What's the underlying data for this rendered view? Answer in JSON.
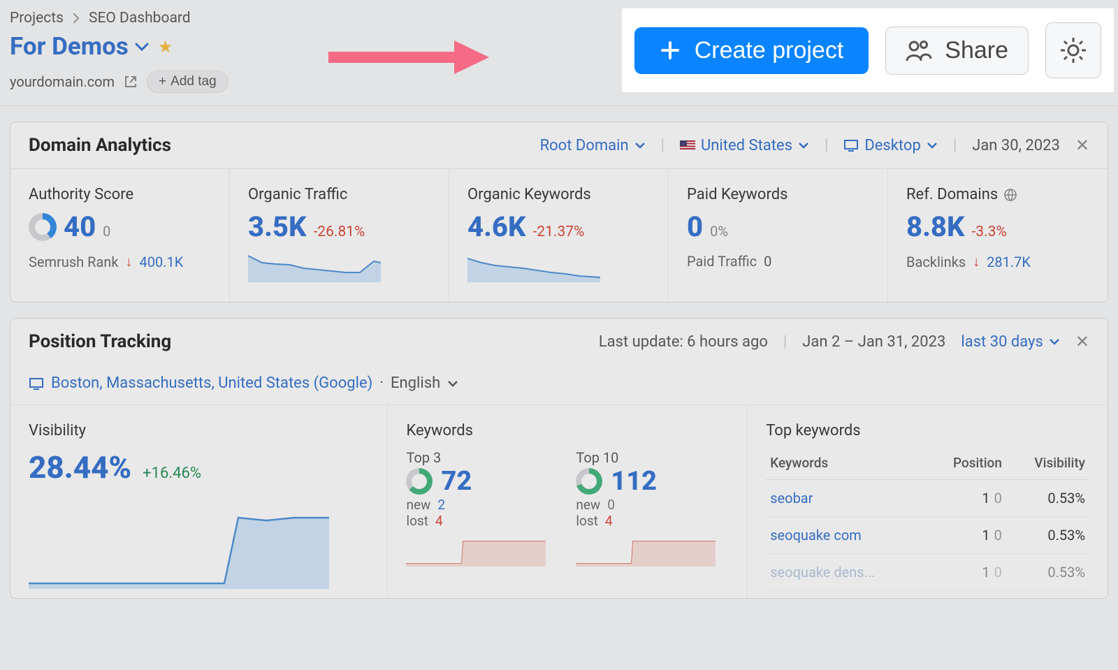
{
  "breadcrumb": {
    "root": "Projects",
    "page": "SEO Dashboard"
  },
  "title": "For Demos",
  "domain": "yourdomain.com",
  "add_tag_label": "Add tag",
  "actions": {
    "create": "Create project",
    "share": "Share"
  },
  "domain_analytics": {
    "title": "Domain Analytics",
    "scope": "Root Domain",
    "region": "United States",
    "device": "Desktop",
    "date": "Jan 30, 2023",
    "metrics": {
      "authority": {
        "label": "Authority Score",
        "value": "40",
        "sub": "0",
        "footer_label": "Semrush Rank",
        "footer_value": "400.1K"
      },
      "organic_traffic": {
        "label": "Organic Traffic",
        "value": "3.5K",
        "delta": "-26.81%"
      },
      "organic_keywords": {
        "label": "Organic Keywords",
        "value": "4.6K",
        "delta": "-21.37%"
      },
      "paid_keywords": {
        "label": "Paid Keywords",
        "value": "0",
        "delta": "0%",
        "footer_label": "Paid Traffic",
        "footer_value": "0"
      },
      "ref_domains": {
        "label": "Ref. Domains",
        "value": "8.8K",
        "delta": "-3.3%",
        "footer_label": "Backlinks",
        "footer_value": "281.7K"
      }
    }
  },
  "position_tracking": {
    "title": "Position Tracking",
    "last_update": "Last update: 6 hours ago",
    "date_range": "Jan 2 – Jan 31, 2023",
    "preset": "last 30 days",
    "location": "Boston, Massachusetts, United States (Google)",
    "language": "English",
    "visibility": {
      "label": "Visibility",
      "value": "28.44%",
      "delta": "+16.46%"
    },
    "keywords": {
      "label": "Keywords",
      "top3": {
        "label": "Top 3",
        "value": "72",
        "new_label": "new",
        "new": "2",
        "lost_label": "lost",
        "lost": "4"
      },
      "top10": {
        "label": "Top 10",
        "value": "112",
        "new_label": "new",
        "new": "0",
        "lost_label": "lost",
        "lost": "4"
      }
    },
    "top_keywords": {
      "label": "Top keywords",
      "cols": {
        "kw": "Keywords",
        "pos": "Position",
        "vis": "Visibility"
      },
      "rows": [
        {
          "kw": "seobar",
          "pos_a": "1",
          "pos_b": "0",
          "vis": "0.53%"
        },
        {
          "kw": "seoquake com",
          "pos_a": "1",
          "pos_b": "0",
          "vis": "0.53%"
        },
        {
          "kw": "seoquake dens...",
          "pos_a": "1",
          "pos_b": "0",
          "vis": "0.53%"
        }
      ]
    }
  },
  "chart_data": [
    {
      "type": "line",
      "series_name": "Organic Traffic",
      "x": [
        0,
        1,
        2,
        3,
        4,
        5,
        6,
        7,
        8,
        9
      ],
      "values": [
        38,
        30,
        28,
        27,
        24,
        22,
        21,
        20,
        20,
        30
      ],
      "ylim": [
        0,
        40
      ]
    },
    {
      "type": "line",
      "series_name": "Organic Keywords",
      "x": [
        0,
        1,
        2,
        3,
        4,
        5,
        6,
        7,
        8,
        9
      ],
      "values": [
        34,
        28,
        25,
        23,
        21,
        19,
        17,
        15,
        13,
        12
      ],
      "ylim": [
        0,
        40
      ]
    },
    {
      "type": "line",
      "series_name": "Visibility",
      "x": [
        0,
        1,
        2,
        3,
        4,
        5,
        6
      ],
      "values": [
        5,
        5,
        5,
        5,
        40,
        39,
        40
      ],
      "ylim": [
        0,
        45
      ]
    },
    {
      "type": "line",
      "series_name": "Top3 trend",
      "x": [
        0,
        1,
        2,
        3,
        4,
        5,
        6
      ],
      "values": [
        3,
        3,
        3,
        18,
        18,
        18,
        18
      ],
      "ylim": [
        0,
        20
      ]
    },
    {
      "type": "line",
      "series_name": "Top10 trend",
      "x": [
        0,
        1,
        2,
        3,
        4,
        5,
        6
      ],
      "values": [
        3,
        3,
        3,
        18,
        18,
        18,
        18
      ],
      "ylim": [
        0,
        20
      ]
    }
  ]
}
